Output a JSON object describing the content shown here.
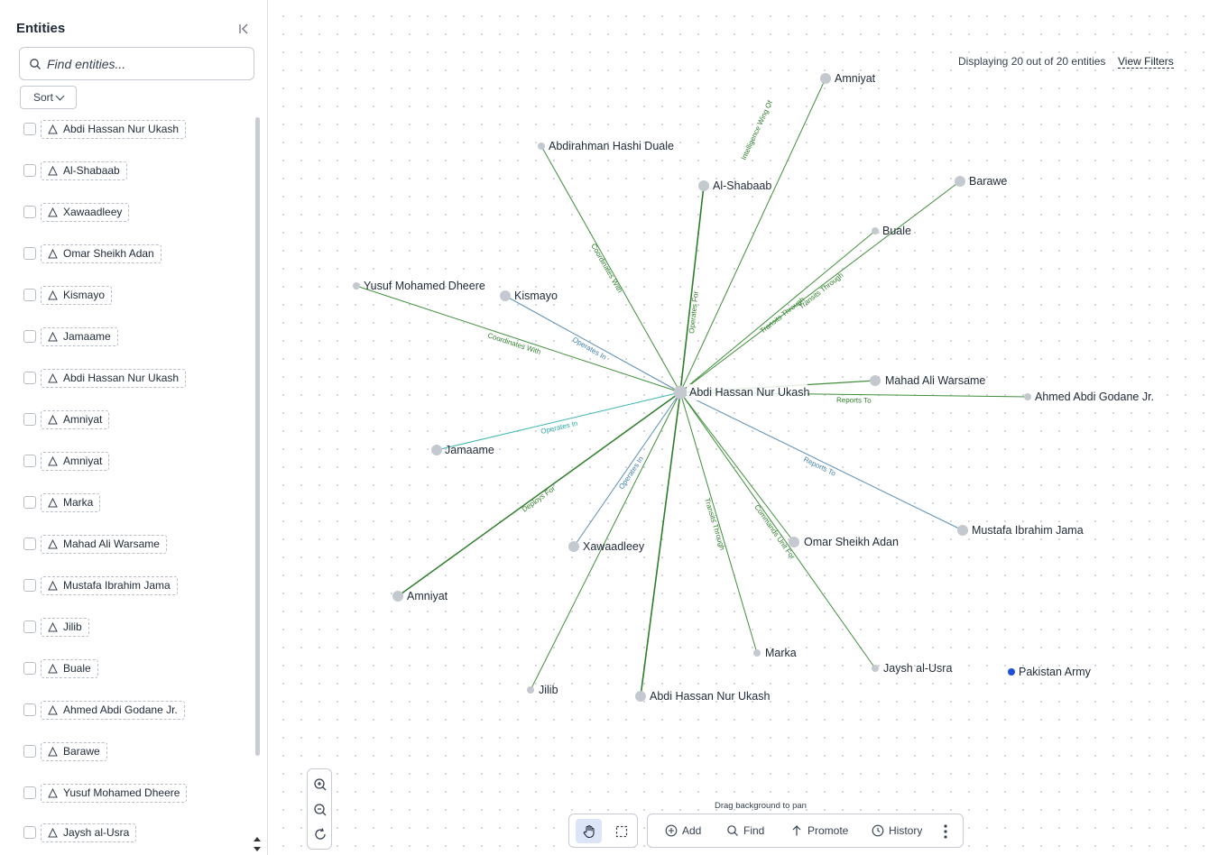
{
  "sidebar": {
    "title": "Entities",
    "collapse_icon": "collapse-left-icon",
    "search_placeholder": "Find entities...",
    "sort_label": "Sort",
    "items": [
      {
        "label": "Abdi Hassan Nur Ukash",
        "icon": "person-icon"
      },
      {
        "label": "Al-Shabaab",
        "icon": "person-icon"
      },
      {
        "label": "Xawaadleey",
        "icon": "person-icon"
      },
      {
        "label": "Omar Sheikh Adan",
        "icon": "person-icon"
      },
      {
        "label": "Kismayo",
        "icon": "person-icon"
      },
      {
        "label": "Jamaame",
        "icon": "person-icon"
      },
      {
        "label": "Abdi Hassan Nur Ukash",
        "icon": "person-icon"
      },
      {
        "label": "Amniyat",
        "icon": "person-icon"
      },
      {
        "label": "Amniyat",
        "icon": "person-icon"
      },
      {
        "label": "Marka",
        "icon": "person-icon"
      },
      {
        "label": "Mahad Ali Warsame",
        "icon": "person-icon"
      },
      {
        "label": "Mustafa Ibrahim Jama",
        "icon": "person-icon"
      },
      {
        "label": "Jilib",
        "icon": "person-icon"
      },
      {
        "label": "Buale",
        "icon": "person-icon"
      },
      {
        "label": "Ahmed Abdi Godane Jr.",
        "icon": "person-icon"
      },
      {
        "label": "Barawe",
        "icon": "person-icon"
      },
      {
        "label": "Yusuf Mohamed Dheere",
        "icon": "person-icon"
      },
      {
        "label": "Jaysh al-Usra",
        "icon": "person-icon"
      }
    ]
  },
  "canvas": {
    "display_info": "Displaying 20 out of 20 entities",
    "view_filters": "View Filters",
    "drag_hint": "Drag background to pan",
    "colors": {
      "green_edge": "#3f8f3a",
      "teal_edge": "#3fb5b0",
      "blue_edge": "#5b8db5",
      "node": "#c4c8cf",
      "highlight": "#1d4ed8"
    }
  },
  "graph": {
    "nodes": [
      {
        "label": "Abdi Hassan Nur Ukash",
        "role": "center"
      },
      {
        "label": "Amniyat"
      },
      {
        "label": "Abdirahman Hashi Duale"
      },
      {
        "label": "Al-Shabaab"
      },
      {
        "label": "Barawe"
      },
      {
        "label": "Buale"
      },
      {
        "label": "Yusuf Mohamed Dheere"
      },
      {
        "label": "Kismayo"
      },
      {
        "label": "Mahad Ali Warsame"
      },
      {
        "label": "Ahmed Abdi Godane Jr."
      },
      {
        "label": "Jamaame"
      },
      {
        "label": "Mustafa Ibrahim Jama"
      },
      {
        "label": "Xawaadleey"
      },
      {
        "label": "Omar Sheikh Adan"
      },
      {
        "label": "Amniyat"
      },
      {
        "label": "Marka"
      },
      {
        "label": "Jaysh al-Usra"
      },
      {
        "label": "Pakistan Army",
        "role": "highlight"
      },
      {
        "label": "Jilib"
      },
      {
        "label": "Abdi Hassan Nur Ukash"
      }
    ],
    "edge_labels": {
      "coordinates_with_1": "Coordinates With",
      "coordinates_with_2": "Coordinates With",
      "operates_in_1": "Operates In",
      "operates_in_2": "Operates In",
      "operates_in_3": "Operates In",
      "transits_through_1": "Transits Through",
      "transits_through_2": "Transits Through",
      "transits_through_3": "Transits Through",
      "reports_to_1": "Reports To",
      "reports_to_2": "Reports To",
      "commands_unit_for": "Commands Unit For",
      "operates_for": "Operates For",
      "intelligence_wing_of": "Intelligence Wing Of",
      "deploys_for": "Deploys For"
    }
  },
  "toolbar": {
    "hand_icon": "hand-icon",
    "select_icon": "marquee-select-icon",
    "add_label": "Add",
    "find_label": "Find",
    "promote_label": "Promote",
    "history_label": "History",
    "more_icon": "more-vertical-icon"
  },
  "zoom": {
    "zoom_in_icon": "zoom-in-icon",
    "zoom_out_icon": "zoom-out-icon",
    "reset_icon": "reset-icon"
  }
}
